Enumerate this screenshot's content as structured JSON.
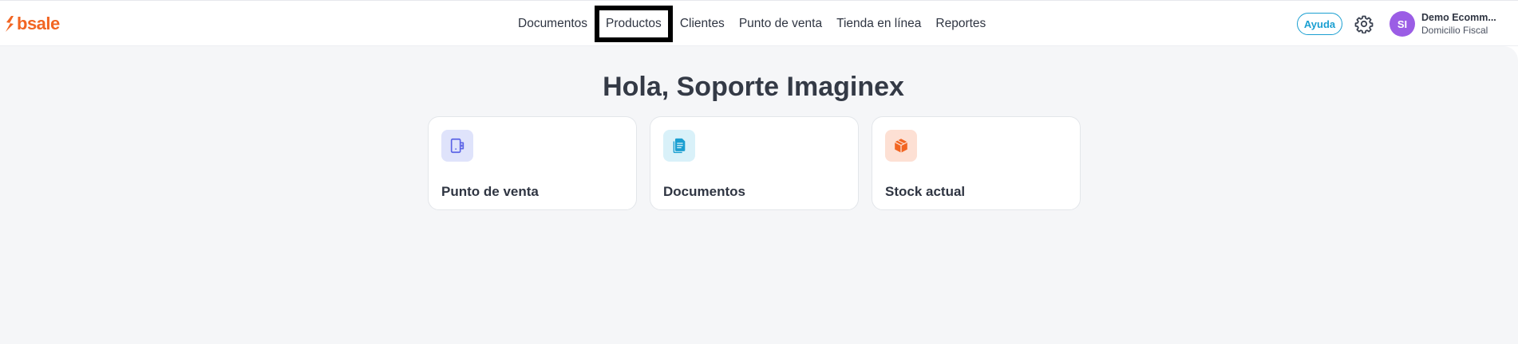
{
  "header": {
    "logo_text": "bsale",
    "nav": [
      {
        "label": "Documentos"
      },
      {
        "label": "Productos"
      },
      {
        "label": "Clientes"
      },
      {
        "label": "Punto de venta"
      },
      {
        "label": "Tienda en línea"
      },
      {
        "label": "Reportes"
      }
    ],
    "help_label": "Ayuda",
    "avatar_initials": "SI",
    "account_name": "Demo Ecomm...",
    "account_sub": "Domicilio Fiscal"
  },
  "main": {
    "greeting": "Hola, Soporte Imaginex",
    "cards": [
      {
        "label": "Punto de venta",
        "icon": "pos-terminal-icon",
        "icon_bg": "#dfe3fb",
        "icon_color": "#5b63e6"
      },
      {
        "label": "Documentos",
        "icon": "documents-icon",
        "icon_bg": "#d9f1f9",
        "icon_color": "#1a9fd1"
      },
      {
        "label": "Stock actual",
        "icon": "box-icon",
        "icon_bg": "#fde0d4",
        "icon_color": "#f26522"
      }
    ]
  },
  "colors": {
    "brand": "#f26522",
    "accent": "#1a9fd1",
    "avatar": "#9b5de5"
  }
}
